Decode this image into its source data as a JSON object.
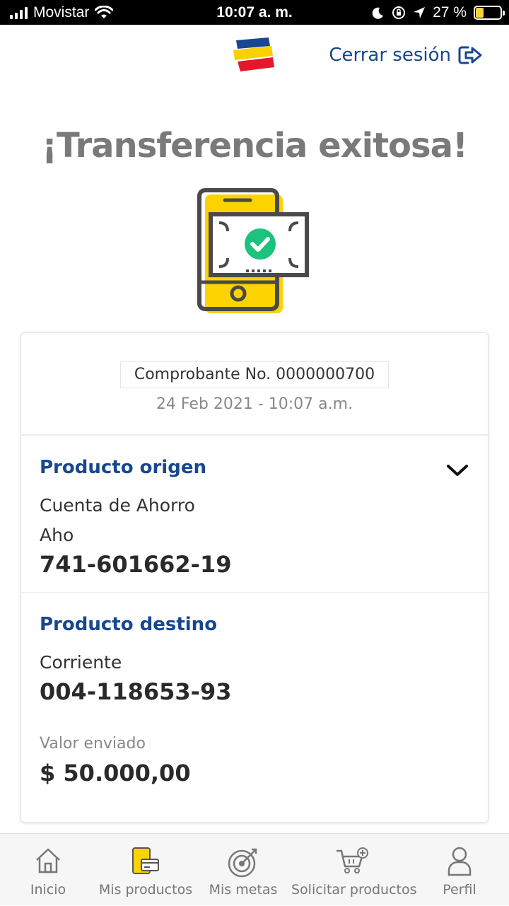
{
  "status_bar": {
    "carrier": "Movistar",
    "time": "10:07 a. m.",
    "battery": "27 %"
  },
  "header": {
    "logout_label": "Cerrar sesión"
  },
  "title": "¡Transferencia exitosa!",
  "receipt": {
    "number_label": "Comprobante No. 0000000700",
    "datetime": "24 Feb 2021 - 10:07 a.m."
  },
  "origin": {
    "title": "Producto origen",
    "account_type": "Cuenta de Ahorro",
    "account_short": "Aho",
    "account_number": "741-601662-19"
  },
  "destination": {
    "title": "Producto destino",
    "account_type": "Corriente",
    "account_number": "004-118653-93",
    "amount_label": "Valor enviado",
    "amount": "$ 50.000,00"
  },
  "bottom_nav": [
    {
      "label": "Inicio",
      "icon": "home-icon"
    },
    {
      "label": "Mis productos",
      "icon": "products-icon"
    },
    {
      "label": "Mis metas",
      "icon": "target-icon"
    },
    {
      "label": "Solicitar productos",
      "icon": "cart-add-icon"
    },
    {
      "label": "Perfil",
      "icon": "user-icon"
    }
  ],
  "colors": {
    "brand_blue": "#17478f",
    "brand_yellow": "#f9d000",
    "brand_red": "#e3182d",
    "success_green": "#1cc27d"
  }
}
